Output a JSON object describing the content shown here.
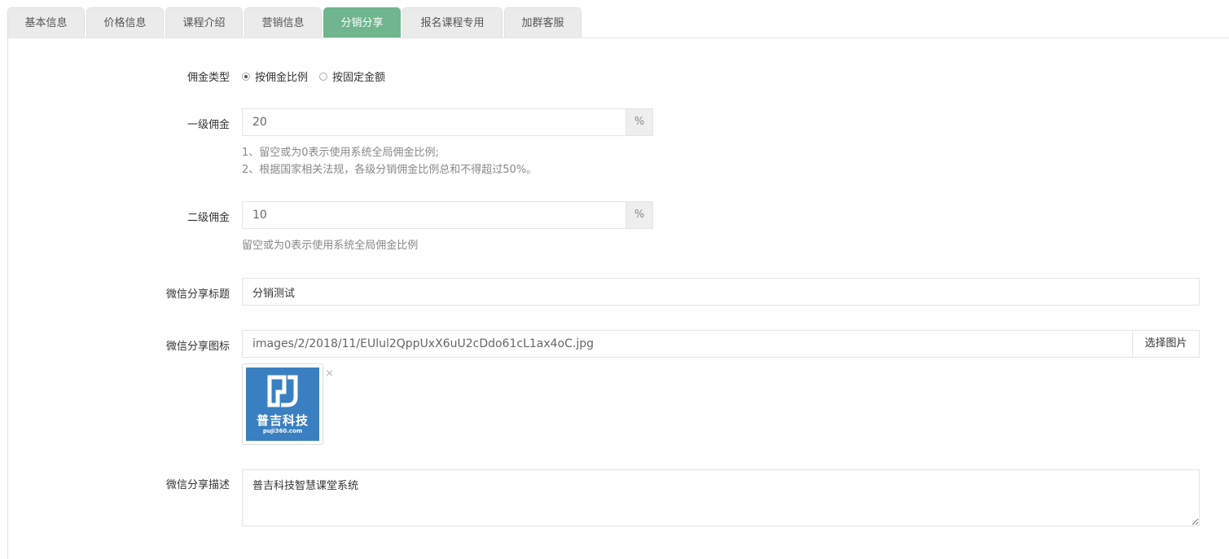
{
  "tabs": [
    {
      "label": "基本信息"
    },
    {
      "label": "价格信息"
    },
    {
      "label": "课程介绍"
    },
    {
      "label": "营销信息"
    },
    {
      "label": "分销分享",
      "active": true
    },
    {
      "label": "报名课程专用"
    },
    {
      "label": "加群客服"
    }
  ],
  "commission_type": {
    "label": "佣金类型",
    "options": [
      {
        "label": "按佣金比例",
        "selected": true
      },
      {
        "label": "按固定金额",
        "selected": false
      }
    ]
  },
  "level1": {
    "label": "一级佣金",
    "value": "20",
    "unit": "%",
    "help": [
      "1、留空或为0表示使用系统全局佣金比例;",
      "2、根据国家相关法规，各级分销佣金比例总和不得超过50%。"
    ]
  },
  "level2": {
    "label": "二级佣金",
    "value": "10",
    "unit": "%",
    "help": "留空或为0表示使用系统全局佣金比例"
  },
  "share_title": {
    "label": "微信分享标题",
    "value": "分销测试"
  },
  "share_icon": {
    "label": "微信分享图标",
    "value": "images/2/2018/11/EUlul2QppUxX6uU2cDdo61cL1ax4oC.jpg",
    "button": "选择图片",
    "remove": "×",
    "logo_text": "普吉科技",
    "logo_sub": "puji360.com"
  },
  "share_desc": {
    "label": "微信分享描述",
    "value": "普吉科技智慧课堂系统"
  },
  "colors": {
    "active_tab": "#6fb58e",
    "logo_bg": "#3a7fc1"
  }
}
